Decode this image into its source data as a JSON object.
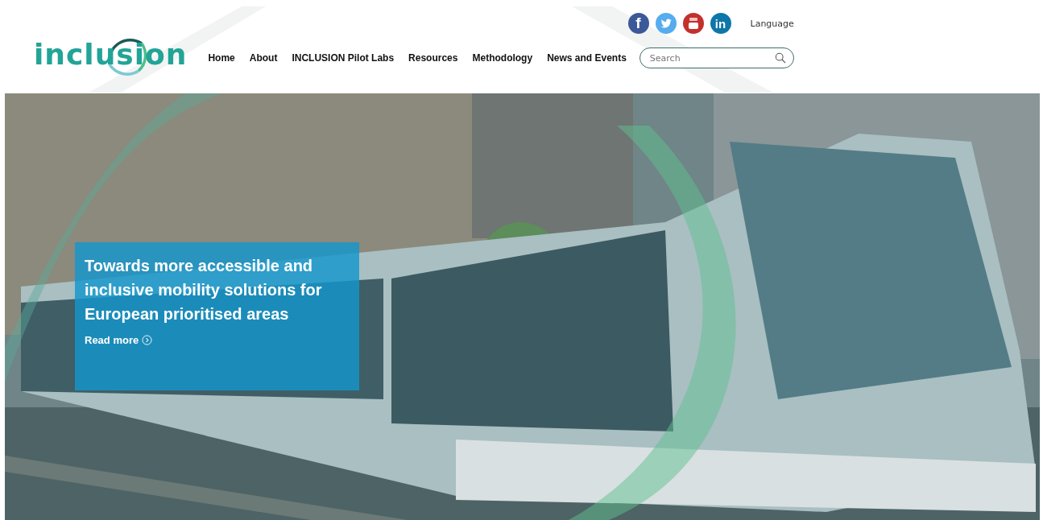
{
  "header": {
    "logo": "inclusion",
    "social": [
      {
        "kind": "facebook",
        "glyph": "f"
      },
      {
        "kind": "twitter"
      },
      {
        "kind": "youtube"
      },
      {
        "kind": "linkedin",
        "glyph": "in"
      }
    ],
    "language": "Language",
    "nav": [
      "Home",
      "About",
      "INCLUSION Pilot Labs",
      "Resources",
      "Methodology",
      "News and Events"
    ],
    "search": {
      "placeholder": "Search"
    }
  },
  "hero": {
    "kind": "picture",
    "caption": {
      "title": "Towards more accessible and inclusive mobility solutions for European prioritised areas",
      "link": "Read more"
    }
  }
}
